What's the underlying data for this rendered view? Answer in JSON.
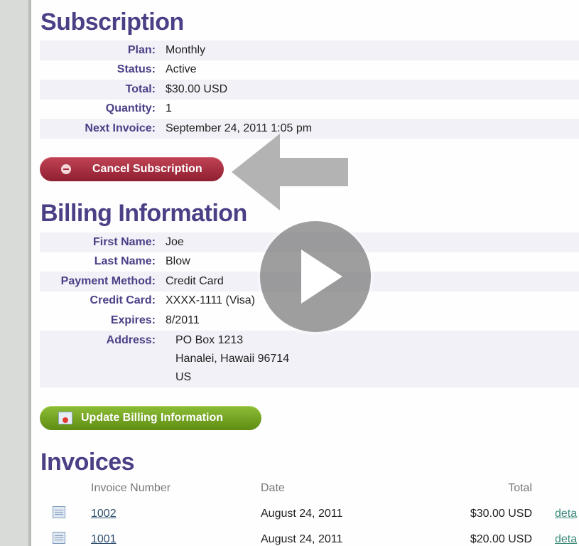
{
  "subscription": {
    "title": "Subscription",
    "rows": [
      {
        "label": "Plan:",
        "value": "Monthly"
      },
      {
        "label": "Status:",
        "value": "Active"
      },
      {
        "label": "Total:",
        "value": "$30.00 USD"
      },
      {
        "label": "Quantity:",
        "value": "1"
      },
      {
        "label": "Next Invoice:",
        "value": "September 24, 2011 1:05 pm"
      }
    ],
    "cancel_label": "Cancel Subscription"
  },
  "billing": {
    "title": "Billing Information",
    "rows": [
      {
        "label": "First Name:",
        "value": "Joe"
      },
      {
        "label": "Last Name:",
        "value": "Blow"
      },
      {
        "label": "Payment Method:",
        "value": "Credit Card"
      },
      {
        "label": "Credit Card:",
        "value": "XXXX-1111 (Visa)"
      },
      {
        "label": "Expires:",
        "value": "8/2011"
      }
    ],
    "address_label": "Address:",
    "address_lines": [
      "PO Box 1213",
      "Hanalei, Hawaii 96714",
      "US"
    ],
    "update_label": "Update Billing Information"
  },
  "invoices": {
    "title": "Invoices",
    "headers": {
      "number": "Invoice Number",
      "date": "Date",
      "total": "Total"
    },
    "rows": [
      {
        "number": "1002",
        "date": "August 24, 2011",
        "total": "$30.00 USD",
        "details": "deta"
      },
      {
        "number": "1001",
        "date": "August 24, 2011",
        "total": "$20.00 USD",
        "details": "deta"
      }
    ]
  },
  "colors": {
    "heading": "#4b3f86",
    "cancel": "#a8283a",
    "update": "#7aa625",
    "link": "#2f4f6f"
  },
  "icons": {
    "cancel": "minus-circle-icon",
    "update": "credit-card-icon",
    "invoice": "document-icon",
    "overlay": "play-icon",
    "pointer": "arrow-left-icon"
  }
}
